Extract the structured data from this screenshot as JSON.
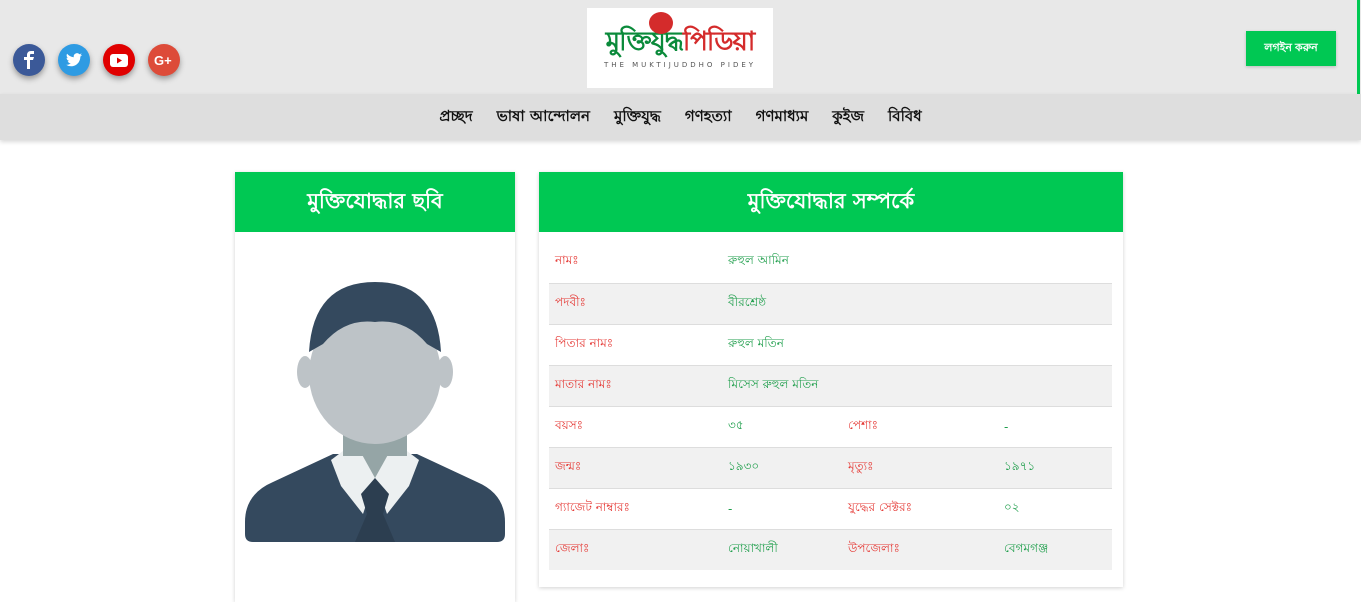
{
  "header": {
    "social": [
      {
        "icon": "facebook-icon",
        "color": "#3b5998"
      },
      {
        "icon": "twitter-icon",
        "color": "#2e9be3"
      },
      {
        "icon": "youtube-icon",
        "color": "#e00000"
      },
      {
        "icon": "google-plus-icon",
        "color": "#dd4b39"
      }
    ],
    "logo": {
      "title_main": "মুক্তিযুদ্ধ",
      "title_accent": "পিডিয়া",
      "subtitle": "THE MUKTIJUDDHO PIDEY"
    },
    "login_label": "লগইন করুন"
  },
  "nav": {
    "items": [
      "প্রচ্ছদ",
      "ভাষা আন্দোলন",
      "মুক্তিযুদ্ধ",
      "গণহত্যা",
      "গণমাধ্যম",
      "কুইজ",
      "বিবিধ"
    ]
  },
  "photo_card": {
    "title": "মুক্তিযোদ্ধার ছবি"
  },
  "info_card": {
    "title": "মুক্তিযোদ্ধার সম্পর্কে",
    "rows": [
      {
        "l1": "নামঃ",
        "v1": "রুহুল আমিন"
      },
      {
        "l1": "পদবীঃ",
        "v1": "বীরশ্রেষ্ঠ"
      },
      {
        "l1": "পিতার নামঃ",
        "v1": "রুহুল মতিন"
      },
      {
        "l1": "মাতার নামঃ",
        "v1": "মিসেস রুহুল মতিন"
      },
      {
        "l1": "বয়সঃ",
        "v1": "৩৫",
        "l2": "পেশাঃ",
        "v2": "-"
      },
      {
        "l1": "জন্মঃ",
        "v1": "১৯৩০",
        "l2": "মৃত্যুঃ",
        "v2": "১৯৭১"
      },
      {
        "l1": "গ্যাজেট নাম্বারঃ",
        "v1": "-",
        "l2": "যুদ্ধের সেক্টরঃ",
        "v2": "০২"
      },
      {
        "l1": "জেলাঃ",
        "v1": "নোয়াখালী",
        "l2": "উপজেলাঃ",
        "v2": "বেগমগঞ্জ"
      }
    ]
  },
  "colors": {
    "accent": "#00c853",
    "label": "#e53935",
    "value": "#1e9e4b"
  }
}
